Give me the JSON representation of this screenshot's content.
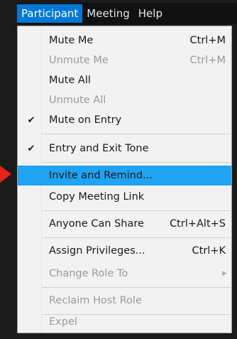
{
  "menubar": {
    "items": [
      {
        "label": "Participant",
        "active": true
      },
      {
        "label": "Meeting",
        "active": false
      },
      {
        "label": "Help",
        "active": false
      }
    ]
  },
  "menu": {
    "items": [
      {
        "label": "Mute Me",
        "shortcut": "Ctrl+M",
        "enabled": true,
        "checked": false
      },
      {
        "label": "Unmute Me",
        "shortcut": "Ctrl+M",
        "enabled": false,
        "checked": false
      },
      {
        "label": "Mute All",
        "shortcut": "",
        "enabled": true,
        "checked": false
      },
      {
        "label": "Unmute All",
        "shortcut": "",
        "enabled": false,
        "checked": false
      },
      {
        "label": "Mute on Entry",
        "shortcut": "",
        "enabled": true,
        "checked": true
      },
      {
        "label": "Entry and Exit Tone",
        "shortcut": "",
        "enabled": true,
        "checked": true
      },
      {
        "label": "Invite and Remind...",
        "shortcut": "",
        "enabled": true,
        "checked": false,
        "highlighted": true
      },
      {
        "label": "Copy Meeting Link",
        "shortcut": "",
        "enabled": true,
        "checked": false
      },
      {
        "label": "Anyone Can Share",
        "shortcut": "Ctrl+Alt+S",
        "enabled": true,
        "checked": false
      },
      {
        "label": "Assign Privileges...",
        "shortcut": "Ctrl+K",
        "enabled": true,
        "checked": false
      },
      {
        "label": "Change Role To",
        "shortcut": "",
        "enabled": false,
        "checked": false,
        "submenu": true
      },
      {
        "label": "Reclaim Host Role",
        "shortcut": "",
        "enabled": false,
        "checked": false
      },
      {
        "label": "Expel",
        "shortcut": "",
        "enabled": false,
        "checked": false
      }
    ],
    "check_glyph": "✔",
    "submenu_glyph": "▶"
  },
  "colors": {
    "menubar_active": "#0078d7",
    "highlight_row": "#1fa3f2",
    "pointer_arrow": "#e8221b"
  },
  "icons": {
    "pointer": "red-arrow-pointer-icon",
    "check": "checkmark-icon",
    "submenu": "submenu-arrow-icon"
  }
}
